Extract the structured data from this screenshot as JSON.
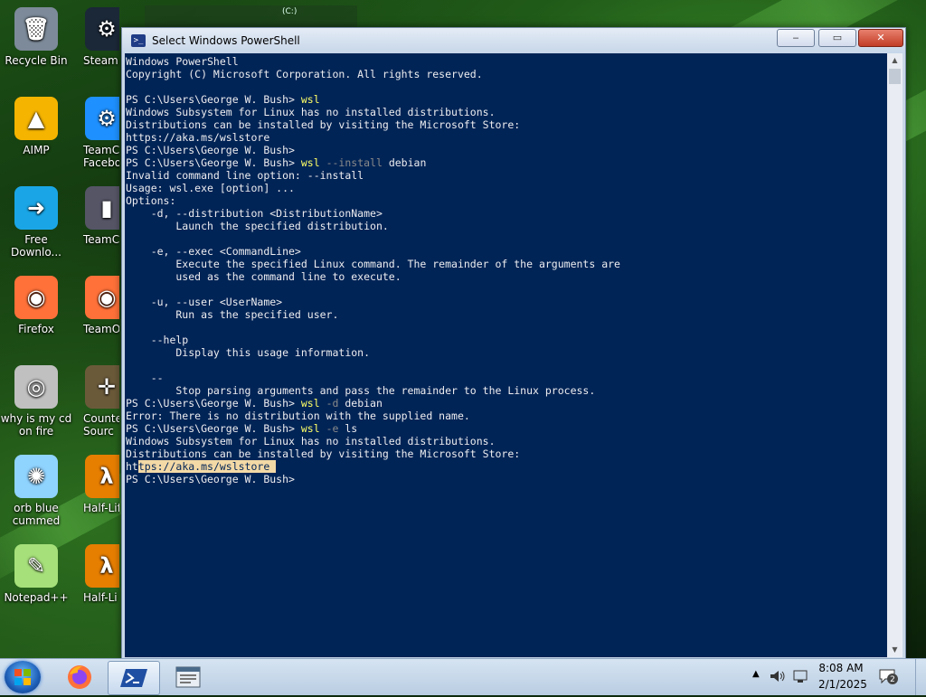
{
  "desktop": {
    "icons_left": [
      {
        "label": "Recycle Bin",
        "icon": "recycle-bin-icon"
      },
      {
        "label": "AIMP",
        "icon": "aimp-icon"
      },
      {
        "label": "Free Downlo...",
        "icon": "free-download-manager-icon"
      },
      {
        "label": "Firefox",
        "icon": "firefox-icon"
      },
      {
        "label": "why is my cd on fire",
        "icon": "cd-on-fire-icon"
      },
      {
        "label": "orb blue cummed",
        "icon": "blue-orb-icon"
      },
      {
        "label": "Notepad++",
        "icon": "notepad-plus-plus-icon"
      }
    ],
    "icons_right": [
      {
        "label": "Steam",
        "icon": "steam-icon"
      },
      {
        "label": "TeamC Facebo",
        "icon": "gear-icon"
      },
      {
        "label": "TeamC",
        "icon": "teamc-icon"
      },
      {
        "label": "TeamOS",
        "icon": "firefox-icon"
      },
      {
        "label": "Counter- Sourc",
        "icon": "counter-strike-icon"
      },
      {
        "label": "Half-Lif",
        "icon": "half-life-icon"
      },
      {
        "label": "Half-Li Sourc",
        "icon": "half-life-icon"
      }
    ],
    "drive_widget": {
      "label": "(C:)"
    }
  },
  "window": {
    "title": "Select Windows PowerShell",
    "minimize": "‒",
    "maximize": "▭",
    "close": "✕"
  },
  "console": {
    "lines": [
      "Windows PowerShell",
      "Copyright (C) Microsoft Corporation. All rights reserved.",
      "",
      "PS C:\\Users\\George W. Bush> wsl",
      "Windows Subsystem for Linux has no installed distributions.",
      "Distributions can be installed by visiting the Microsoft Store:",
      "https://aka.ms/wslstore",
      "PS C:\\Users\\George W. Bush>",
      "PS C:\\Users\\George W. Bush> wsl --install debian",
      "Invalid command line option: --install",
      "Usage: wsl.exe [option] ...",
      "Options:",
      "    -d, --distribution <DistributionName>",
      "        Launch the specified distribution.",
      "",
      "    -e, --exec <CommandLine>",
      "        Execute the specified Linux command. The remainder of the arguments are",
      "        used as the command line to execute.",
      "",
      "    -u, --user <UserName>",
      "        Run as the specified user.",
      "",
      "    --help",
      "        Display this usage information.",
      "",
      "    --",
      "        Stop parsing arguments and pass the remainder to the Linux process.",
      "PS C:\\Users\\George W. Bush> wsl -d debian",
      "Error: There is no distribution with the supplied name.",
      "PS C:\\Users\\George W. Bush> wsl -e ls",
      "Windows Subsystem for Linux has no installed distributions.",
      "Distributions can be installed by visiting the Microsoft Store:",
      "https://aka.ms/wslstore",
      "PS C:\\Users\\George W. Bush>"
    ],
    "commands": {
      "3": {
        "cmd": "wsl",
        "args": ""
      },
      "8": {
        "cmd": "wsl",
        "args": " --install",
        "rest": " debian"
      },
      "27": {
        "cmd": "wsl",
        "args": " -d",
        "rest": " debian"
      },
      "29": {
        "cmd": "wsl",
        "args": " -e",
        "rest": " ls"
      }
    },
    "selection": {
      "line": 32,
      "start": 2,
      "end": 23
    }
  },
  "taskbar": {
    "clock_time": "8:08 AM",
    "clock_date": "2/1/2025",
    "notification_count": "2",
    "colors": {
      "console_bg": "#012456",
      "command": "#ffff66",
      "parameter": "#8a8a8a",
      "selection": "#f3d9a6"
    }
  }
}
